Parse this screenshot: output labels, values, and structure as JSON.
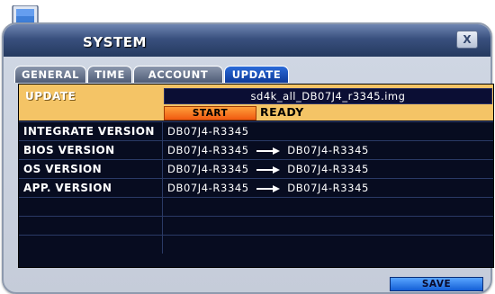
{
  "window": {
    "title": "SYSTEM",
    "close_label": "X"
  },
  "tabs": [
    {
      "label": "GENERAL",
      "active": false
    },
    {
      "label": "TIME",
      "active": false
    },
    {
      "label": "ACCOUNT",
      "active": false
    },
    {
      "label": "UPDATE",
      "active": true
    }
  ],
  "update": {
    "label": "UPDATE",
    "filename": "sd4k_all_DB07J4_r3345.img",
    "start_label": "START",
    "status": "READY"
  },
  "versions": [
    {
      "label": "INTEGRATE VERSION",
      "current": "DB07J4-R3345",
      "target": ""
    },
    {
      "label": "BIOS VERSION",
      "current": "DB07J4-R3345",
      "target": "DB07J4-R3345"
    },
    {
      "label": "OS VERSION",
      "current": "DB07J4-R3345",
      "target": "DB07J4-R3345"
    },
    {
      "label": "APP. VERSION",
      "current": "DB07J4-R3345",
      "target": "DB07J4-R3345"
    }
  ],
  "footer": {
    "save_label": "SAVE"
  },
  "colors": {
    "update_row": "#f4c466",
    "panel_bg": "#070c20",
    "active_tab": "#1a4fc0",
    "start_button": "#f57a1f",
    "save_button": "#2a7af0"
  },
  "icons": [
    "computer-icon",
    "close-icon",
    "arrow-right-icon"
  ]
}
